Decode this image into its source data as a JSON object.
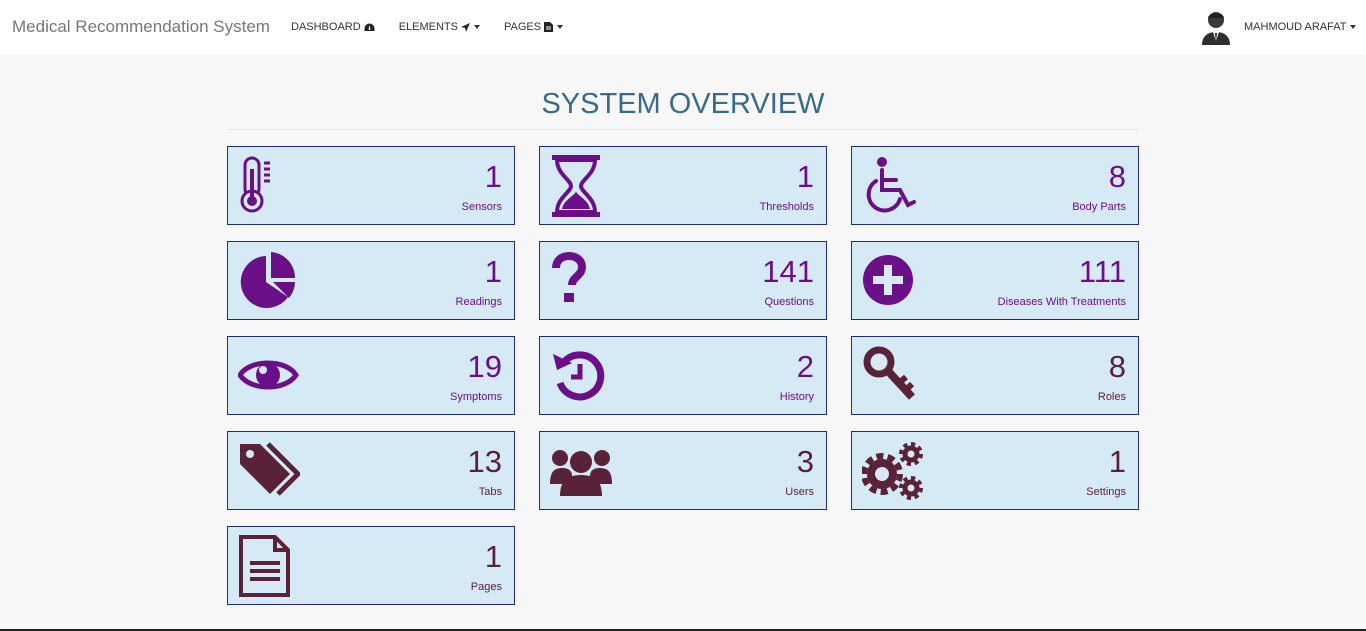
{
  "navbar": {
    "brand": "Medical Recommendation System",
    "items": [
      {
        "label": "DASHBOARD",
        "icon": "dashboard-icon"
      },
      {
        "label": "ELEMENTS",
        "icon": "location-arrow-icon"
      },
      {
        "label": "PAGES",
        "icon": "file-icon"
      }
    ],
    "user": {
      "name": "MAHMOUD ARAFAT",
      "avatar_icon": "user-avatar-icon"
    }
  },
  "main": {
    "title": "SYSTEM OVERVIEW",
    "tiles": [
      {
        "count": "1",
        "label": "Sensors",
        "icon": "thermometer-icon",
        "color": "#6a0f87"
      },
      {
        "count": "1",
        "label": "Thresholds",
        "icon": "hourglass-icon",
        "color": "#6a0f87"
      },
      {
        "count": "8",
        "label": "Body Parts",
        "icon": "wheelchair-icon",
        "color": "#6a0f87"
      },
      {
        "count": "1",
        "label": "Readings",
        "icon": "pie-chart-icon",
        "color": "#6a0f87"
      },
      {
        "count": "141",
        "label": "Questions",
        "icon": "question-icon",
        "color": "#6a0f87"
      },
      {
        "count": "111",
        "label": "Diseases With Treatments",
        "icon": "plus-circle-icon",
        "color": "#6a0f87"
      },
      {
        "count": "19",
        "label": "Symptoms",
        "icon": "eye-icon",
        "color": "#6a0f87"
      },
      {
        "count": "2",
        "label": "History",
        "icon": "history-icon",
        "color": "#6a0f87"
      },
      {
        "count": "8",
        "label": "Roles",
        "icon": "key-icon",
        "color": "#5a2238"
      },
      {
        "count": "13",
        "label": "Tabs",
        "icon": "tags-icon",
        "color": "#5a2238"
      },
      {
        "count": "3",
        "label": "Users",
        "icon": "users-icon",
        "color": "#5a2238"
      },
      {
        "count": "1",
        "label": "Settings",
        "icon": "cogs-icon",
        "color": "#5a2238"
      },
      {
        "count": "1",
        "label": "Pages",
        "icon": "document-icon",
        "color": "#5a2238"
      }
    ]
  }
}
